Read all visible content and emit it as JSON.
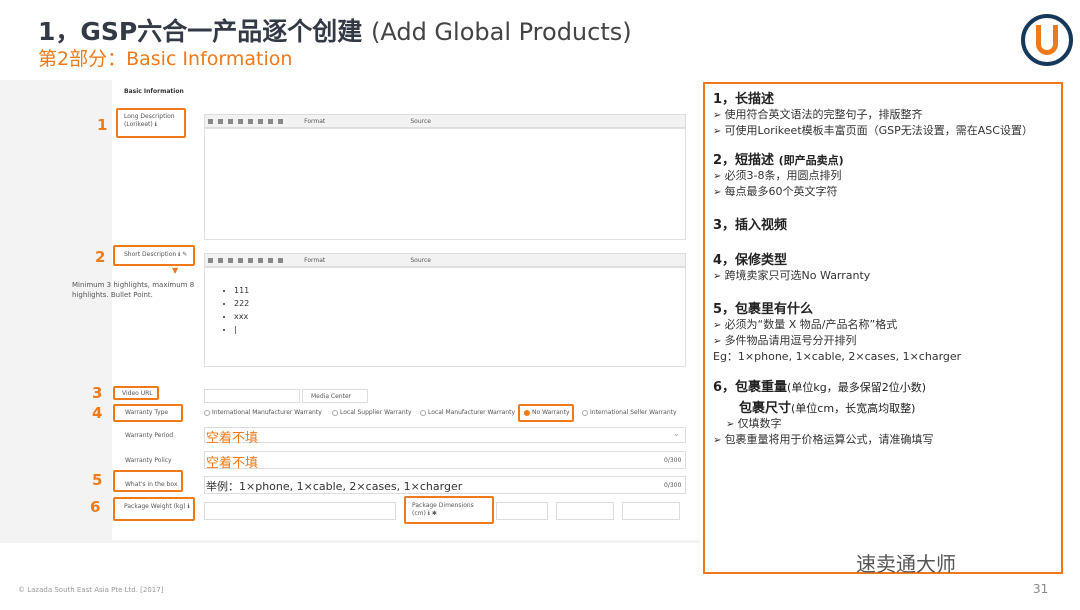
{
  "header": {
    "title_cn": "1，GSP六合一产品逐个创建",
    "title_en": "(Add Global Products)",
    "subtitle": "第2部分：Basic Information"
  },
  "form": {
    "section_title": "Basic Information",
    "long_desc_label": "Long Description (Lorikeet) ℹ",
    "short_desc_label": "Short Description ℹ ✎",
    "short_desc_hint": "Minimum 3 highlights, maximum 8 highlights. Bullet Point.",
    "toolbar_format": "Format",
    "toolbar_source": "Source",
    "bullets": [
      "111",
      "222",
      "xxx",
      "|"
    ],
    "video_label": "Video URL",
    "media_center": "Media Center",
    "warranty_type_label": "Warranty Type",
    "warranty_options": [
      "International Manufacturer Warranty",
      "Local Supplier Warranty",
      "Local Manufacturer Warranty",
      "No Warranty",
      "International Seller Warranty"
    ],
    "warranty_period_label": "Warranty Period",
    "warranty_policy_label": "Warranty Policy",
    "in_box_label": "What's in the box",
    "weight_label": "Package Weight (kg) ℹ",
    "dimensions_label": "Package Dimensions (cm) ℹ ✱",
    "counter1": "0/300",
    "counter2": "0/300",
    "annotation_empty": "空着不填",
    "annotation_empty2": "空着不填",
    "annotation_example": "举例：1×phone, 1×cable, 2×cases, 1×charger"
  },
  "markers": [
    "1",
    "2",
    "3",
    "4",
    "5",
    "6"
  ],
  "notes": {
    "s1_title": "1，长描述",
    "s1_b1": "使用符合英文语法的完整句子，排版整齐",
    "s1_b2": "可使用Lorikeet模板丰富页面（GSP无法设置，需在ASC设置）",
    "s2_title": "2，短描述",
    "s2_sub": "(即产品卖点)",
    "s2_b1": "必须3-8条，用圆点排列",
    "s2_b2": "每点最多60个英文字符",
    "s3_title": "3，插入视频",
    "s4_title": "4，保修类型",
    "s4_b1": "跨境卖家只可选No Warranty",
    "s5_title": "5，包裹里有什么",
    "s5_b1": "必须为“数量 X 物品/产品名称”格式",
    "s5_b2": "多件物品请用逗号分开排列",
    "s5_eg": "Eg：1×phone, 1×cable, 2×cases, 1×charger",
    "s6_title": "6，包裹重量",
    "s6_sub": "(单位kg，最多保留2位小数)",
    "s6_title2": "包裹尺寸",
    "s6_sub2": "(单位cm，长宽高均取整)",
    "s6_b1": "仅填数字",
    "s6_b2": "包裹重量将用于价格运算公式，请准确填写"
  },
  "footer": {
    "copyright": "© Lazada South East Asia Pte Ltd. [2017]",
    "page_number": "31",
    "wechat": "速卖通大师"
  },
  "colors": {
    "accent": "#f07a1a",
    "navy": "#16385a"
  }
}
